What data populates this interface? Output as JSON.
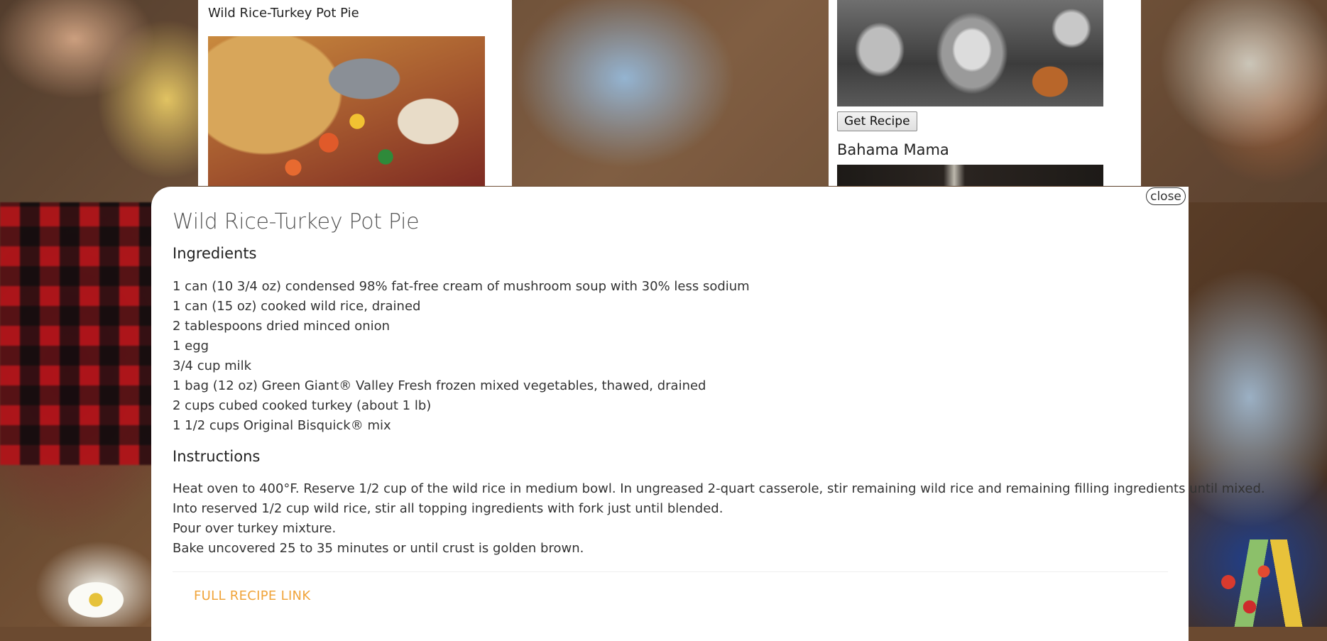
{
  "cards": {
    "left": {
      "title": "Wild Rice-Turkey Pot Pie"
    },
    "right": {
      "button_label": "Get Recipe",
      "next_title": "Bahama Mama"
    }
  },
  "modal": {
    "close_label": "close",
    "title": "Wild Rice-Turkey Pot Pie",
    "ingredients_heading": "Ingredients",
    "ingredients": [
      "1 can (10 3/4 oz) condensed 98% fat-free cream of mushroom soup with 30% less sodium",
      "1 can (15 oz) cooked wild rice, drained",
      "2 tablespoons dried minced onion",
      "1 egg",
      "3/4 cup milk",
      "1 bag (12 oz) Green Giant® Valley Fresh frozen mixed vegetables, thawed, drained",
      "2 cups cubed cooked turkey (about 1 lb)",
      "1 1/2 cups Original Bisquick® mix"
    ],
    "instructions_heading": "Instructions",
    "instructions": [
      "Heat oven to 400°F. Reserve 1/2 cup of the wild rice in medium bowl. In ungreased 2-quart casserole, stir remaining wild rice and remaining filling ingredients until mixed.",
      "Into reserved 1/2 cup wild rice, stir all topping ingredients with fork just until blended.",
      "Pour over turkey mixture.",
      "Bake uncovered 25 to 35 minutes or until crust is golden brown."
    ],
    "full_recipe_link": "FULL RECIPE LINK"
  },
  "colors": {
    "link_accent": "#f0a43a",
    "modal_background": "#ffffff"
  }
}
